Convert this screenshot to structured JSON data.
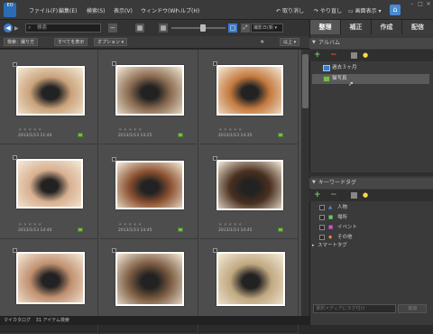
{
  "app": {
    "logo": "EO"
  },
  "menu": [
    "ファイル(F)",
    "編集(E)",
    "検索(S)",
    "表示(V)",
    "ウィンドウ(W)",
    "ヘルプ(H)"
  ],
  "titlebar": {
    "undo": "取り消し",
    "redo": "やり直し",
    "display": "画面表示"
  },
  "tabs": [
    {
      "label": "整理",
      "active": true
    },
    {
      "label": "補正"
    },
    {
      "label": "作成"
    },
    {
      "label": "配信"
    }
  ],
  "toolbar": {
    "search_placeholder": "検索",
    "sort": "撮影日(新"
  },
  "filterbar": {
    "search_label": "検索：撮り方",
    "show_all": "すべてを表示",
    "options": "オプション",
    "rating": "以上"
  },
  "photos": [
    {
      "date": "2013/1/13 11:44",
      "color": "#caa27a"
    },
    {
      "date": "2013/1/13 14:25",
      "color": "#8a6a50"
    },
    {
      "date": "2013/1/13 14:35",
      "color": "#c57a40"
    },
    {
      "date": "2013/1/13 14:40",
      "color": "#d8b090"
    },
    {
      "date": "2013/1/13 14:45",
      "color": "#8a5030"
    },
    {
      "date": "2013/1/13 14:45",
      "color": "#4a3020"
    },
    {
      "date": "",
      "color": "#c09070"
    },
    {
      "date": "",
      "color": "#7a5a40"
    },
    {
      "date": "",
      "color": "#c0a880"
    }
  ],
  "stars": "★★★★★",
  "status": {
    "catalog": "マイカタログ",
    "count": "31 アイテム検索"
  },
  "album_panel": {
    "title": "アルバム",
    "items": [
      "過去３ヶ月",
      "猫写真"
    ]
  },
  "keyword_panel": {
    "title": "キーワードタグ",
    "items": [
      "人物",
      "場所",
      "イベント",
      "その他"
    ],
    "smart": "スマートタグ"
  },
  "keyword_search_placeholder": "選択メディアにタグ付け",
  "apply_label": "追加"
}
